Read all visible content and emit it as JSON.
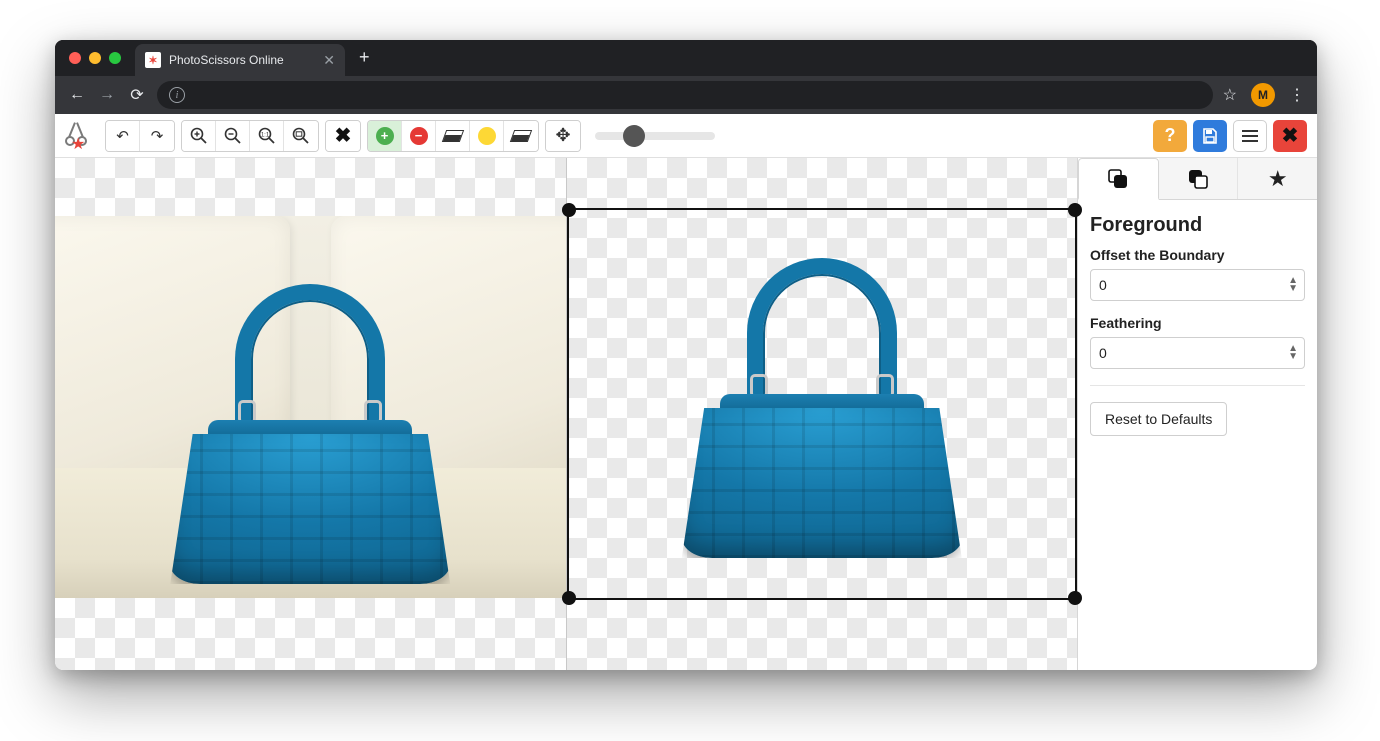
{
  "browser": {
    "tab_title": "PhotoScissors Online",
    "avatar_initial": "M"
  },
  "toolbar": {
    "icons": {
      "undo": "undo-icon",
      "redo": "redo-icon",
      "zoom_in": "zoom-in-icon",
      "zoom_out": "zoom-out-icon",
      "zoom_1to1": "zoom-actual-icon",
      "zoom_fit": "zoom-fit-icon",
      "clear": "clear-marks-icon",
      "mark_fg": "mark-foreground-icon",
      "mark_bg": "mark-background-icon",
      "eraser1": "eraser-icon",
      "mark_yellow": "mark-highlight-icon",
      "eraser2": "eraser-icon",
      "move": "move-icon",
      "help": "help-icon",
      "save": "save-icon",
      "menu": "menu-icon",
      "close": "close-icon"
    },
    "brush_slider_value": 25
  },
  "side_panel": {
    "tabs": {
      "foreground": "foreground-tab-icon",
      "background": "background-tab-icon",
      "effects": "effects-tab-icon"
    },
    "active_tab": "foreground",
    "title": "Foreground",
    "offset_label": "Offset the Boundary",
    "offset_value": "0",
    "feathering_label": "Feathering",
    "feathering_value": "0",
    "reset_label": "Reset to Defaults"
  },
  "colors": {
    "accent_blue": "#2f7bdc",
    "accent_orange": "#f2a93b",
    "accent_red": "#e8443a",
    "fg_green": "#4caf50",
    "bg_red": "#e53935",
    "hl_yellow": "#fdd835"
  }
}
